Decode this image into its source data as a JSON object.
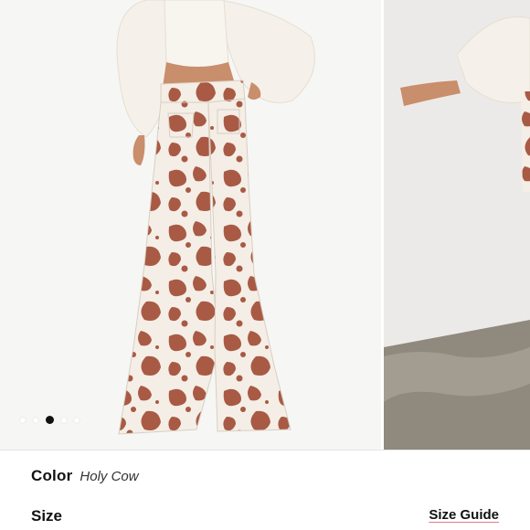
{
  "product_gallery": {
    "current_slide": 3,
    "total_slides": 5
  },
  "options": {
    "color_label": "Color",
    "color_value": "Holy Cow",
    "size_label": "Size",
    "size_guide_label": "Size Guide"
  },
  "colors": {
    "print_brown": "#a85a45",
    "print_cream": "#f4eee6",
    "top_white": "#f5f1ea",
    "skin": "#c98e6b",
    "active_dot": "#111111"
  }
}
